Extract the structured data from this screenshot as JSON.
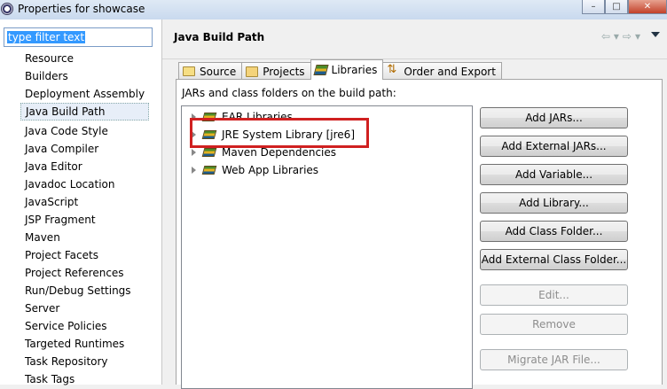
{
  "window": {
    "title": "Properties for showcase",
    "controls": {
      "minimize": "–",
      "maximize": "□",
      "close": "✕"
    }
  },
  "filter": {
    "value": "type filter text"
  },
  "nav_items": [
    "Resource",
    "Builders",
    "Deployment Assembly",
    "Java Build Path",
    "Java Code Style",
    "Java Compiler",
    "Java Editor",
    "Javadoc Location",
    "JavaScript",
    "JSP Fragment",
    "Maven",
    "Project Facets",
    "Project References",
    "Run/Debug Settings",
    "Server",
    "Service Policies",
    "Targeted Runtimes",
    "Task Repository",
    "Task Tags"
  ],
  "selected_nav_index": 3,
  "page": {
    "title": "Java Build Path",
    "nav_icons": {
      "back": "⇦",
      "back_menu": "▾",
      "forward": "⇨",
      "forward_menu": "▾"
    }
  },
  "tabs": [
    {
      "label": "Source",
      "icon": "source-folder-icon"
    },
    {
      "label": "Projects",
      "icon": "projects-folder-icon"
    },
    {
      "label": "Libraries",
      "icon": "libraries-icon",
      "active": true
    },
    {
      "label": "Order and Export",
      "icon": "order-export-icon"
    }
  ],
  "build_path_label": "JARs and class folders on the build path:",
  "libraries": [
    "EAR Libraries",
    "JRE System Library [jre6]",
    "Maven Dependencies",
    "Web App Libraries"
  ],
  "buttons": [
    {
      "label": "Add JARs...",
      "enabled": true
    },
    {
      "label": "Add External JARs...",
      "enabled": true
    },
    {
      "label": "Add Variable...",
      "enabled": true
    },
    {
      "label": "Add Library...",
      "enabled": true
    },
    {
      "label": "Add Class Folder...",
      "enabled": true
    },
    {
      "label": "Add External Class Folder...",
      "enabled": true
    },
    {
      "label": "Edit...",
      "enabled": false
    },
    {
      "label": "Remove",
      "enabled": false
    },
    {
      "label": "Migrate JAR File...",
      "enabled": false
    }
  ],
  "colors": {
    "highlight": "#d02020",
    "selection": "#3399ff"
  }
}
